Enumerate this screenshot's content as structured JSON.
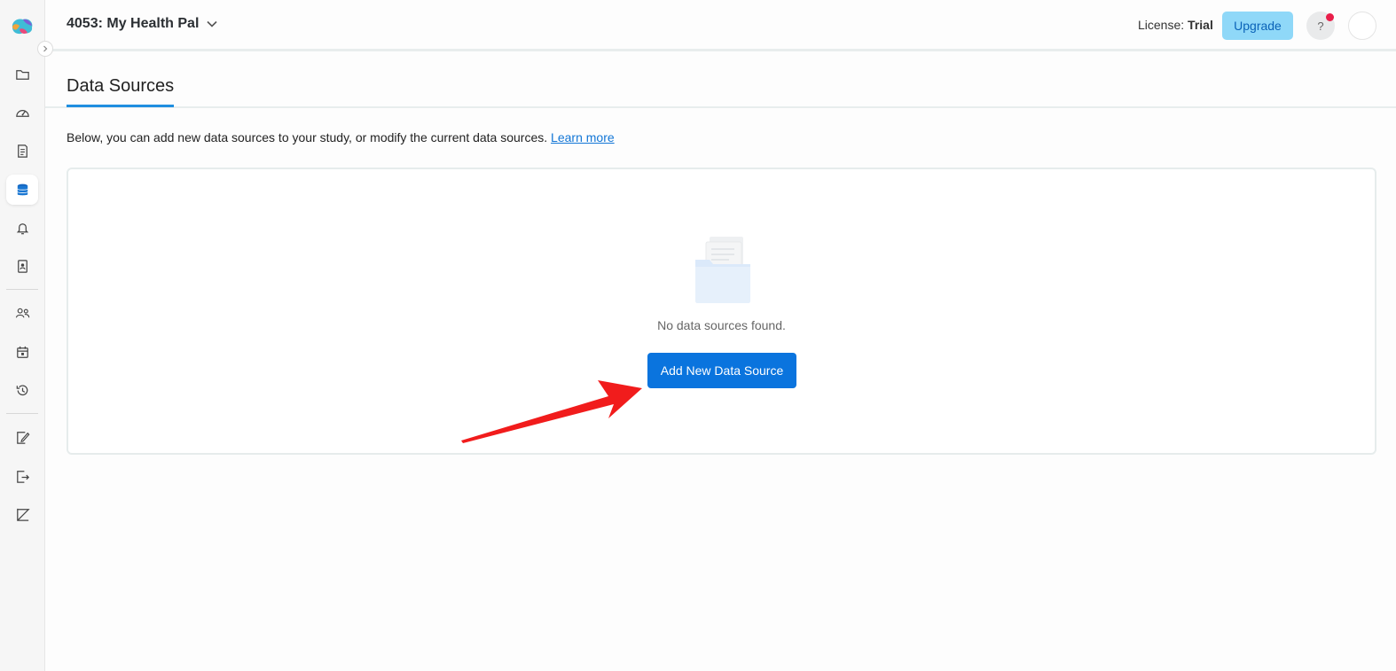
{
  "sidebar": {
    "items": [
      {
        "icon": "folder-icon"
      },
      {
        "icon": "dashboard-gauge-icon"
      },
      {
        "icon": "document-icon"
      },
      {
        "icon": "database-icon",
        "active": true
      },
      {
        "icon": "bell-icon"
      },
      {
        "icon": "contact-card-icon"
      },
      {
        "icon": "users-icon"
      },
      {
        "icon": "calendar-icon"
      },
      {
        "icon": "history-icon"
      },
      {
        "icon": "edit-document-icon"
      },
      {
        "icon": "export-document-icon"
      },
      {
        "icon": "chart-icon"
      }
    ]
  },
  "header": {
    "project_title": "4053: My Health Pal",
    "license_label": "License:",
    "license_value": "Trial",
    "upgrade_label": "Upgrade",
    "help_label": "?"
  },
  "tabs": {
    "active_label": "Data Sources"
  },
  "main": {
    "intro_text": "Below, you can add new data sources to your study, or modify the current data sources.",
    "learn_more_label": "Learn more",
    "empty_text": "No data sources found.",
    "add_button_label": "Add New Data Source"
  },
  "colors": {
    "accent": "#0a74de",
    "upgrade_bg": "#8fd8f8",
    "notification": "#e91e4a",
    "annotation_arrow": "#f11c1c"
  }
}
